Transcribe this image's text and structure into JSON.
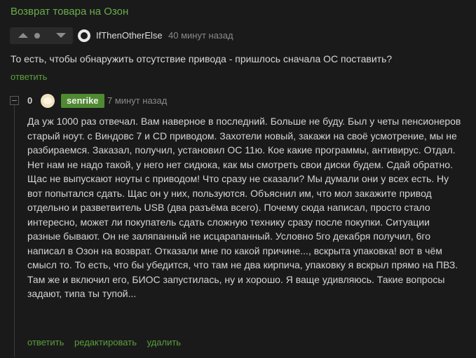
{
  "post": {
    "title": "Возврат товара на Озон"
  },
  "parent_comment": {
    "username": "IfThenOtherElse",
    "time": "40 минут назад",
    "text": "То есть, чтобы обнаружить отсутствие привода - пришлось сначала ОС поставить?",
    "reply_label": "ответить",
    "avatar_icon": "user-avatar-icon",
    "vote_icons": [
      "upvote-icon",
      "vote-neutral-icon",
      "downvote-icon"
    ]
  },
  "reply_comment": {
    "score": "0",
    "username": "senrike",
    "time": "7 минут назад",
    "lines": [
      "Да уж 1000 раз отвечал. Вам наверное в последний. Больше не буду. Был у четы пенсионеров",
      "старый ноут. с Виндовс 7 и CD приводом. Захотели новый, закажи на своё усмотрение, мы не",
      "разбираемся. Заказал, получил, установил ОС 11ю. Кое какие программы, антивирус. Отдал.",
      "Нет нам не надо такой, у него нет сидюка, как мы смотреть свои диски будем. Сдай обратно.",
      "Щас не выпускают ноуты с приводом! Что сразу не сказали? Мы думали они у всех есть. Ну",
      "вот попытался сдать. Щас он у них, пользуются. Объяснил им, что мол закажите привод",
      "отдельно и разветвитель USB (два разъёма всего). Почему сюда написал, просто стало",
      "интересно, может ли покупатель сдать сложную технику сразу после покупки. Ситуации",
      "разные бывают. Он не заляпанный не исцарапанный. Условно 5го декабря получил, 6го",
      "написал в Озон на возврат. Отказали мне по какой причине..., вскрыта упаковка! вот в чём",
      "смысл то. То есть, что бы убедится, что там не два кирпича, упаковку я вскрыл прямо на ПВЗ.",
      "Там же и включил его, БИОС запустилась, ну и хорошо. Я ваще удивляюсь. Такие вопросы",
      "задают, типа ты тупой..."
    ],
    "actions": {
      "reply": "ответить",
      "edit": "редактировать",
      "delete": "удалить"
    }
  },
  "colors": {
    "accent_green": "#5b9f3b",
    "badge_green": "#4f8a32",
    "background": "#1a1a1b"
  }
}
